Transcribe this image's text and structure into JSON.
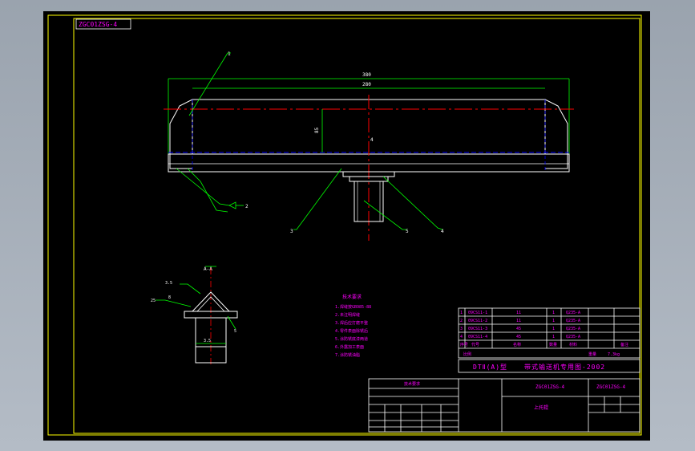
{
  "drawing": {
    "code_box": "ZGC01ZSG-4",
    "title": "DTⅡ(A)型 带式输送机专用图-2002",
    "title_left": "DTⅡ(A)型",
    "title_right": "带式输送机专用图-2002",
    "scale_label": "比例",
    "weight_label": "重量",
    "weight_value": "7.3kg",
    "notes_heading": "技术要求",
    "notes": [
      "1.焊缝按GB985-88",
      "2.未注明焊缝",
      "3.焊后应打磨平整",
      "4.零件表面除锈后",
      "5.涂防锈底漆两道",
      "6.外露加工表面",
      "7.涂防锈油脂"
    ],
    "parts_header": [
      "序号",
      "代号",
      "名称",
      "数量",
      "材料",
      "备注"
    ],
    "parts": [
      [
        "1",
        "09CS11-1",
        "11",
        "1",
        "Q235-A",
        ""
      ],
      [
        "2",
        "09CS11-2",
        "11",
        "1",
        "Q235-A",
        ""
      ],
      [
        "3",
        "09CS11-3",
        "45",
        "1",
        "Q235-A",
        ""
      ],
      [
        "4",
        "09CS11-4",
        "45",
        "1",
        "Q235-A",
        ""
      ]
    ],
    "drawing_number": "ZGC01ZSG-4",
    "part_name": "上托辊",
    "dimensions": {
      "overall": "380",
      "inner": "280",
      "height": "85",
      "side": "4"
    },
    "callouts": [
      "1",
      "2",
      "3",
      "4",
      "5",
      "6"
    ],
    "section_label": "A-A",
    "detail_labels": [
      "3.5",
      "25",
      "8",
      "5",
      "3.5"
    ]
  },
  "colors": {
    "background": "#000000",
    "border": "#ffff00",
    "geometry": "#ffffff",
    "dimension": "#00ff00",
    "centerline": "#ff0000",
    "hidden": "#0000ff",
    "text": "#ff00ff"
  }
}
